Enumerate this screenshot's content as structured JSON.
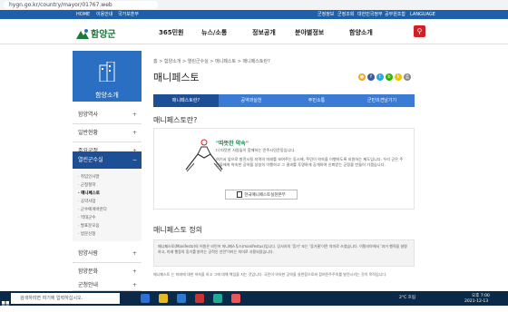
{
  "browser": {
    "url": "hygn.go.kr/country/mayor/01767.web"
  },
  "topnav": {
    "left": [
      "HOME",
      "이용안내",
      "국가보훈부"
    ],
    "right": [
      "군정정보",
      "군정조회",
      "대한민국정부",
      "공무원조합",
      "LANGUAGE"
    ]
  },
  "header": {
    "logo": "함양군",
    "menu": [
      "365민원",
      "뉴스/소통",
      "정보공개",
      "분야별정보",
      "함양소개"
    ],
    "search_icon": "search-icon"
  },
  "sidebar": {
    "title": "함양소개",
    "items": [
      {
        "label": "함양역사"
      },
      {
        "label": "일반현황"
      },
      {
        "label": "주요군정"
      },
      {
        "label": "열린군수실"
      }
    ],
    "sub_items": [
      "· 취임인사말",
      "· 군정철학",
      "· 매니페스토",
      "· 공약사업",
      "· 군수에게바란다",
      "· 역대군수",
      "· 발표문모음",
      "· 방문신청"
    ],
    "more_items": [
      {
        "label": "함양사람"
      },
      {
        "label": "함양문화"
      },
      {
        "label": "군청안내"
      }
    ]
  },
  "breadcrumb": "홈 > 함양소개 > 열린군수실 > 매니페스토 > 매니페스토란?",
  "page_title": "매니페스토",
  "tabs": [
    "매니페스토란?",
    "공약과실천",
    "주민소통",
    "군민의견남기기"
  ],
  "section1": {
    "title": "매니페스토란?",
    "quote": "\"따뜻한 약속\"",
    "subquote": "더 따뜻한 사람들이 함께하는 민주시민운동입니다.",
    "body": "여기서 앞으로 발전시킬 지역의 미래를 보여주는 동시에, 주민이 약속을 이행하도록 지원하는 제도입니다. 우리 군은 주민들에게 약속한 공약을 성실히 이행하고 그 결과를 투명하게 공개하여 신뢰받는 군정을 만들어 가겠습니다.",
    "button": "한국매니페스토실천본부"
  },
  "section2": {
    "title": "매니페스토 정의",
    "def": "매니페스토(Manifesto)의 어원은 라틴어 마니페스투스(manifestus)입니다. 당사자의 '증거' 또는 '증거물'이란 의미로 쓰였습니다. 이탈리아에서 '과거 행적을 설명하고, 미래 행동의 동기를 밝히는 공적인 선언'이라는 의미로 사용되었습니다.",
    "para": "매니페스토 는 미래에 대한 약속을 하고 그에 대해 책임을 지는 것입니다. 국민이 약속한 공약을 실천함으로써 참여민주주의를 발전시키는 것이 목적입니다."
  },
  "taskbar": {
    "search_placeholder": "검색하려면 여기에 입력하십시오.",
    "time": "오후 7:00",
    "date": "2021-12-13",
    "temp": "2°C 흐림"
  },
  "colors": {
    "primary": "#1d4f96",
    "tab_active": "#1d4f96",
    "tab": "#3a7bd5",
    "green": "#1a8a4a",
    "red": "#d41f26"
  }
}
